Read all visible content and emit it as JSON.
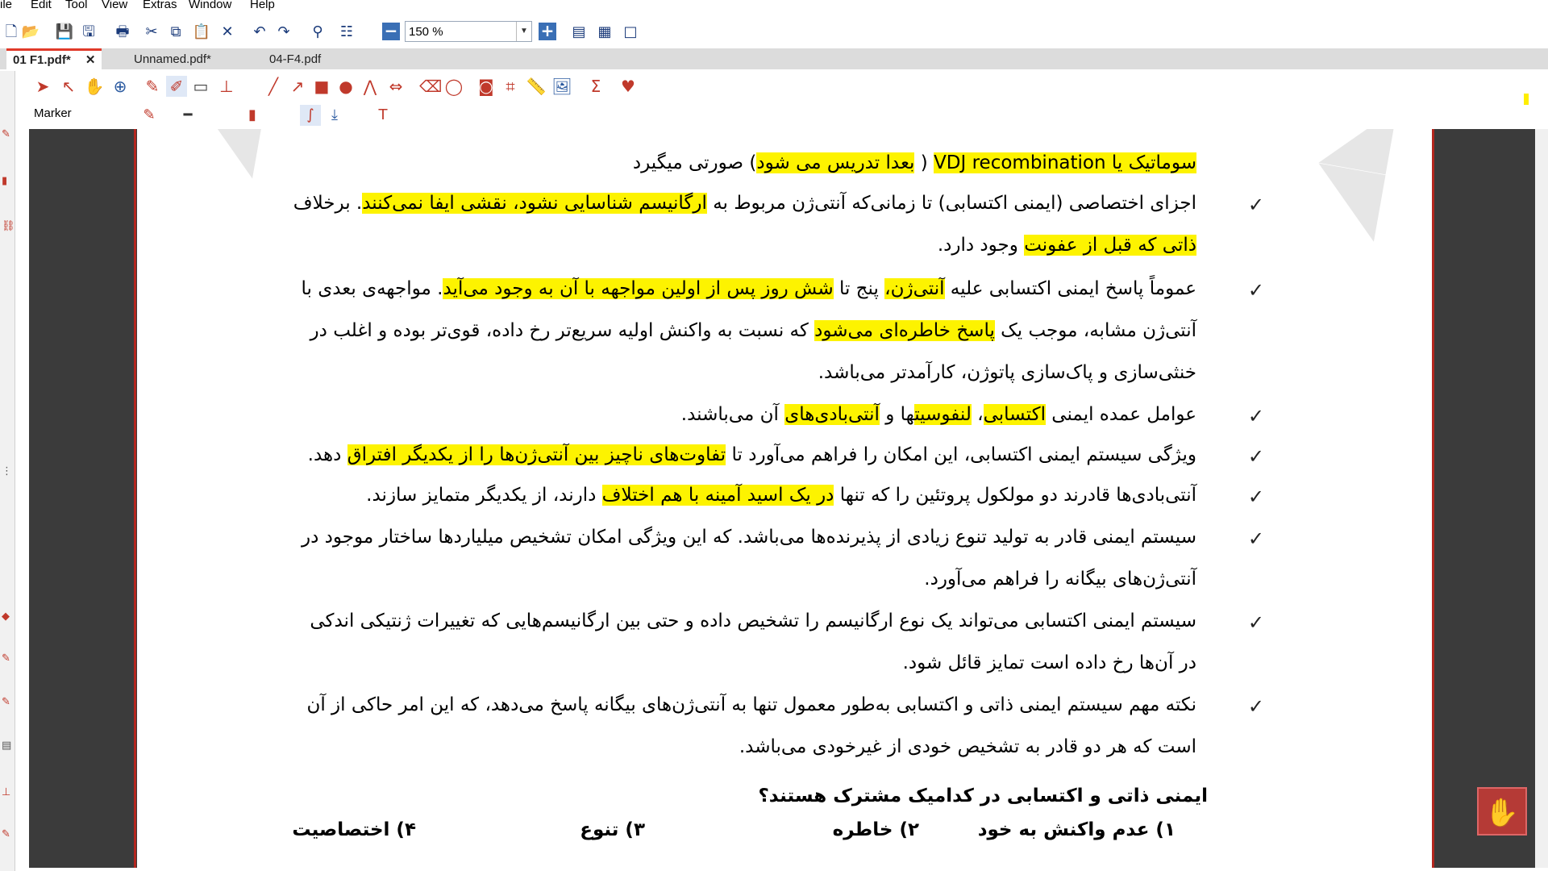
{
  "menu": [
    "ile",
    "Edit",
    "Tool",
    "View",
    "Extras",
    "Window",
    "Help"
  ],
  "toolbar": {
    "zoom_value": "150 %",
    "icons": [
      "new-icon",
      "open-icon",
      "save-icon",
      "save-as-icon",
      "print-icon",
      "cut-icon",
      "copy-icon",
      "paste-icon",
      "delete-icon",
      "undo-icon",
      "redo-icon",
      "find-icon",
      "layout-icon",
      "zoom-out-icon",
      "zoom-in-icon",
      "page-fit-icon",
      "fit-width-icon",
      "fullscreen-icon"
    ]
  },
  "tabs": [
    {
      "label": "01 F1.pdf*",
      "active": true,
      "close": "✕"
    },
    {
      "label": "Unnamed.pdf*",
      "active": false
    },
    {
      "label": "04-F4.pdf",
      "active": false
    }
  ],
  "tools": {
    "current_tool_label": "Marker"
  },
  "document": {
    "lines": [
      {
        "text": "سوماتیک یا VDJ recombination ( بعدا تدریس می شود) صورتی میگیرد",
        "check": false
      },
      {
        "text": "اجزای اختصاصی (ایمنی اکتسابی) تا زمانی‌که آنتی‌ژن مربوط به ارگانیسم شناسایی نشود، نقشی ایفا نمی‌کنند. برخلاف",
        "check": true
      },
      {
        "text": "ذاتی که قبل از عفونت وجود دارد.",
        "check": false
      },
      {
        "text": "عموماً پاسخ ایمنی اکتسابی علیه آنتی‌ژن، پنج تا شش روز پس از اولین مواجهه با آن به وجود می‌آید. مواجهه‌ی بعدی با",
        "check": true
      },
      {
        "text": "آنتی‌ژن مشابه، موجب یک پاسخ خاطره‌ای می‌شود که نسبت به واکنش اولیه سریع‌تر رخ داده، قوی‌تر بوده و اغلب در",
        "check": false
      },
      {
        "text": "خنثی‌سازی و پاک‌سازی پاتوژن، کارآمدتر می‌باشد.",
        "check": false
      },
      {
        "text": "عوامل عمده ایمنی اکتسابی، لنفوسیت‌ها و آنتی‌بادی‌های آن می‌باشند.",
        "check": true
      },
      {
        "text": "ویژگی سیستم ایمنی اکتسابی، این امکان را فراهم می‌آورد تا تفاوت‌های ناچیز بین آنتی‌ژن‌ها را از یکدیگر افتراق دهد.",
        "check": true
      },
      {
        "text": "آنتی‌بادی‌ها قادرند دو مولکول پروتئین را که تنها در یک اسید آمینه با هم اختلاف دارند، از یکدیگر متمایز سازند.",
        "check": true
      },
      {
        "text": "سیستم ایمنی قادر به تولید تنوع زیادی از پذیرنده‌ها می‌باشد. که این ویژگی امکان تشخیص میلیاردها ساختار موجود در",
        "check": true
      },
      {
        "text": "آنتی‌ژن‌های بیگانه را فراهم می‌آورد.",
        "check": false
      },
      {
        "text": "سیستم ایمنی اکتسابی می‌تواند یک نوع ارگانیسم را تشخیص داده و حتی بین ارگانیسم‌هایی که تغییرات ژنتیکی اندکی",
        "check": true
      },
      {
        "text": "در آن‌ها رخ داده است تمایز قائل شود.",
        "check": false
      },
      {
        "text": "نکته مهم سیستم ایمنی ذاتی و اکتسابی به‌طور معمول تنها به آنتی‌ژن‌های بیگانه پاسخ می‌دهد، که این امر حاکی از آن",
        "check": true
      },
      {
        "text": "است که هر دو قادر به تشخیص خودی از غیرخودی می‌باشد.",
        "check": false
      }
    ],
    "question": "ایمنی ذاتی و اکتسابی در کدامیک مشترک هستند؟",
    "options": [
      "۱) عدم واکنش به خود",
      "۲) خاطره",
      "۳) تنوع",
      "۴) اختصاصیت"
    ],
    "check_mark": "✓"
  },
  "colors": {
    "highlight": "#fdf300",
    "accent_red": "#b3261e",
    "doc_background": "#3b3b3b"
  }
}
